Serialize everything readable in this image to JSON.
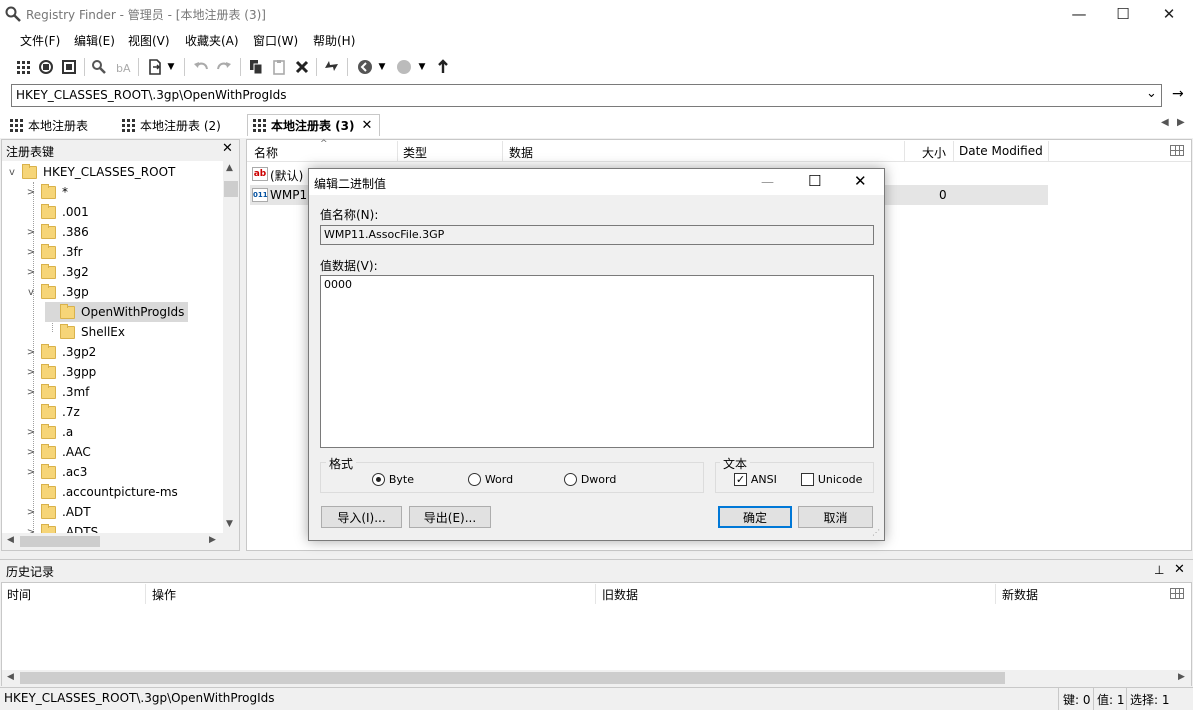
{
  "window": {
    "title": "Registry Finder - 管理员 - [本地注册表 (3)]",
    "minimize_glyph": "—",
    "maximize_glyph": "☐",
    "close_glyph": "✕"
  },
  "menu": [
    "文件(F)",
    "编辑(E)",
    "视图(V)",
    "收藏夹(A)",
    "窗口(W)",
    "帮助(H)"
  ],
  "address": {
    "value": "HKEY_CLASSES_ROOT\\.3gp\\OpenWithProgIds",
    "dropdown_glyph": "⌄",
    "go_glyph": "→"
  },
  "tabs": [
    {
      "label": "本地注册表",
      "active": false
    },
    {
      "label": "本地注册表 (2)",
      "active": false
    },
    {
      "label": "本地注册表 (3)",
      "active": true
    }
  ],
  "tab_close_glyph": "✕",
  "tab_nav": {
    "prev": "◀",
    "next": "▶"
  },
  "tree_panel": {
    "title": "注册表键",
    "close_glyph": "✕",
    "root": "HKEY_CLASSES_ROOT",
    "items": [
      {
        "label": "*",
        "expander": ">"
      },
      {
        "label": ".001",
        "expander": ""
      },
      {
        "label": ".386",
        "expander": ">"
      },
      {
        "label": ".3fr",
        "expander": ">"
      },
      {
        "label": ".3g2",
        "expander": ">"
      },
      {
        "label": ".3gp",
        "expander": "v"
      },
      {
        "label": "OpenWithProgIds",
        "expander": ""
      },
      {
        "label": "ShellEx",
        "expander": ""
      },
      {
        "label": ".3gp2",
        "expander": ">"
      },
      {
        "label": ".3gpp",
        "expander": ">"
      },
      {
        "label": ".3mf",
        "expander": ">"
      },
      {
        "label": ".7z",
        "expander": ""
      },
      {
        "label": ".a",
        "expander": ">"
      },
      {
        "label": ".AAC",
        "expander": ">"
      },
      {
        "label": ".ac3",
        "expander": ">"
      },
      {
        "label": ".accountpicture-ms",
        "expander": ""
      },
      {
        "label": ".ADT",
        "expander": ">"
      },
      {
        "label": ".ADTS",
        "expander": ">"
      }
    ]
  },
  "values_panel": {
    "columns": [
      "名称",
      "类型",
      "数据",
      "大小",
      "Date Modified"
    ],
    "rows": [
      {
        "icon_text": "ab",
        "name": "(默认)",
        "size": ""
      },
      {
        "icon_text": "011",
        "name": "WMP1",
        "size": "0"
      }
    ]
  },
  "dialog": {
    "title": "编辑二进制值",
    "name_label": "值名称(N):",
    "name_value": "WMP11.AssocFile.3GP",
    "data_label": "值数据(V):",
    "data_value": "0000",
    "format_group": "格式",
    "format_options": [
      "Byte",
      "Word",
      "Dword"
    ],
    "format_selected": "Byte",
    "text_group": "文本",
    "text_options": [
      {
        "label": "ANSI",
        "checked": true
      },
      {
        "label": "Unicode",
        "checked": false
      }
    ],
    "import_button": "导入(I)...",
    "export_button": "导出(E)...",
    "ok_button": "确定",
    "cancel_button": "取消"
  },
  "history_panel": {
    "title": "历史记录",
    "pin_glyph": "⊥",
    "close_glyph": "✕",
    "columns": [
      "时间",
      "操作",
      "旧数据",
      "新数据"
    ]
  },
  "status": {
    "path": "HKEY_CLASSES_ROOT\\.3gp\\OpenWithProgIds",
    "keys": "键: 0",
    "values": "值: 1",
    "selected": "选择: 1"
  }
}
